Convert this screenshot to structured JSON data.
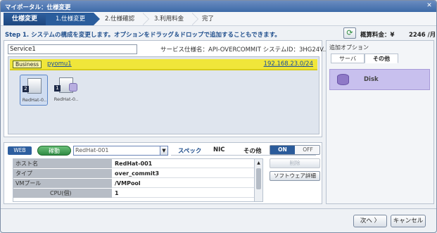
{
  "window": {
    "title": "マイポータル：仕様変更",
    "close_icon": "close-icon"
  },
  "steps": {
    "main": "仕様変更",
    "items": [
      {
        "label": "1.仕様変更",
        "active": true
      },
      {
        "label": "2.仕様確認",
        "active": false
      },
      {
        "label": "3.利用料金",
        "active": false
      },
      {
        "label": "完了",
        "active": false
      }
    ]
  },
  "instruction": "Step 1. システムの構成を変更します。オプションをドラッグ＆ドロップで追加することもできます。",
  "fee": {
    "label": "概算料金：¥",
    "value": "2246 /月",
    "refresh_icon": "refresh-icon"
  },
  "service": {
    "name": "Service1",
    "info": "サービス仕様名：API-OVERCOMMIT  システムID：3HG24V..."
  },
  "network": {
    "badge": "Business",
    "name": "pyomu1",
    "ip": "192.168.23.0/24"
  },
  "servers": [
    {
      "num": "2",
      "label": "RedHat-0..",
      "selected": true
    },
    {
      "num": "1",
      "label": "RedHat-0..",
      "selected": false
    }
  ],
  "detail": {
    "web_label": "WEB",
    "run_label": "稼動",
    "hostname_value": "RedHat-001",
    "tabs": [
      "スペック",
      "NIC",
      "その他"
    ],
    "rows": [
      {
        "key": "ホスト名",
        "value": "RedHat-001"
      },
      {
        "key": "タイプ",
        "value": "over_commit3"
      },
      {
        "key": "VMプール",
        "value": "/VMPool"
      },
      {
        "key": "CPU(個)",
        "value": "1"
      }
    ]
  },
  "power": {
    "on": "ON",
    "off": "OFF",
    "delete": "削除",
    "software": "ソフトウェア詳細"
  },
  "options": {
    "title": "追加オプション",
    "tabs": [
      "サーバ",
      "その他"
    ],
    "item": "Disk"
  },
  "footer": {
    "next": "次へ 〉",
    "cancel": "キャンセル"
  }
}
